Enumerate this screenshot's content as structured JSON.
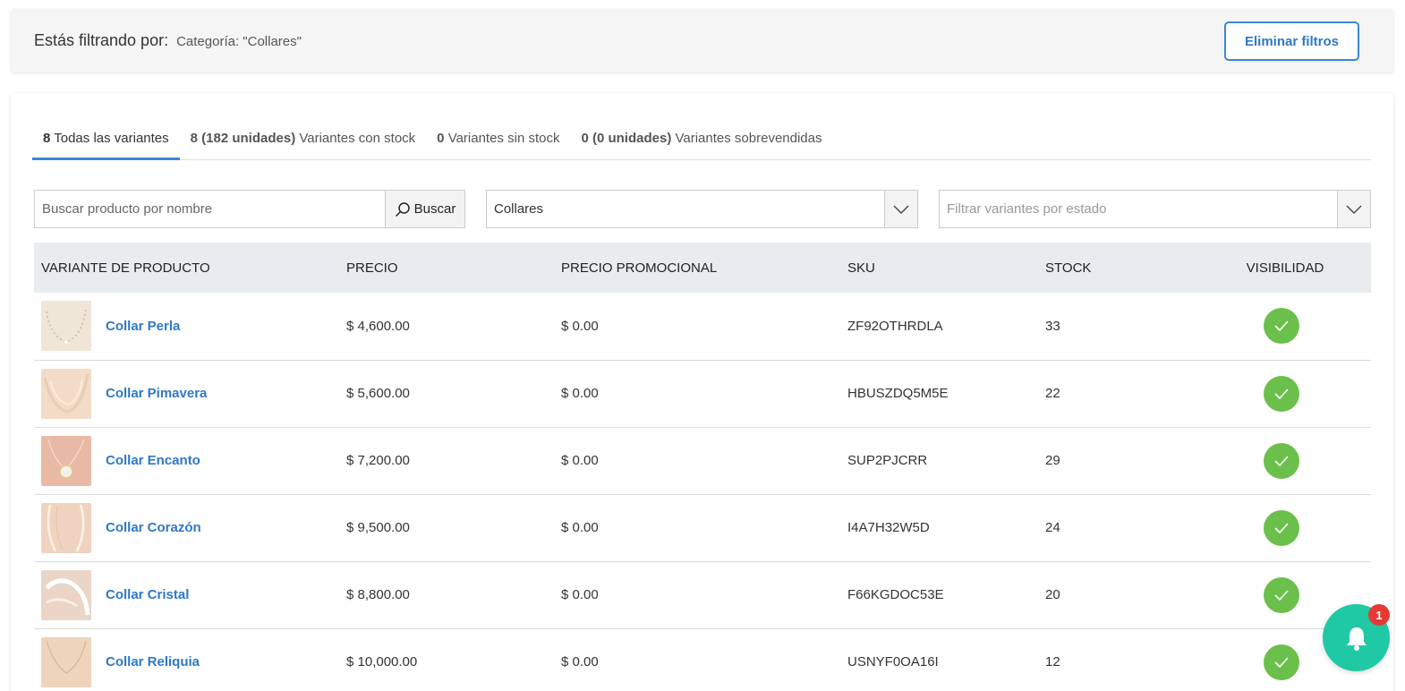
{
  "filter_bar": {
    "title": "Estás filtrando por:",
    "value": "Categoría: \"Collares\"",
    "clear_button": "Eliminar filtros"
  },
  "tabs": [
    {
      "count": "8",
      "label": "Todas las variantes",
      "active": true
    },
    {
      "count": "8 (182 unidades)",
      "label": "Variantes con stock",
      "active": false
    },
    {
      "count": "0",
      "label": "Variantes sin stock",
      "active": false
    },
    {
      "count": "0 (0 unidades)",
      "label": "Variantes sobrevendidas",
      "active": false
    }
  ],
  "search": {
    "placeholder": "Buscar producto por nombre",
    "button_label": "Buscar",
    "icon": "search-icon"
  },
  "category_select": {
    "value": "Collares"
  },
  "status_select": {
    "placeholder": "Filtrar variantes por estado"
  },
  "table": {
    "headers": [
      "VARIANTE DE PRODUCTO",
      "PRECIO",
      "PRECIO PROMOCIONAL",
      "SKU",
      "STOCK",
      "VISIBILIDAD"
    ],
    "rows": [
      {
        "name": "Collar Perla",
        "price": "$ 4,600.00",
        "promo": "$ 0.00",
        "sku": "ZF92OTHRDLA",
        "stock": "33",
        "visible": true
      },
      {
        "name": "Collar Pimavera",
        "price": "$ 5,600.00",
        "promo": "$ 0.00",
        "sku": "HBUSZDQ5M5E",
        "stock": "22",
        "visible": true
      },
      {
        "name": "Collar Encanto",
        "price": "$ 7,200.00",
        "promo": "$ 0.00",
        "sku": "SUP2PJCRR",
        "stock": "29",
        "visible": true
      },
      {
        "name": "Collar Corazón",
        "price": "$ 9,500.00",
        "promo": "$ 0.00",
        "sku": "I4A7H32W5D",
        "stock": "24",
        "visible": true
      },
      {
        "name": "Collar Cristal",
        "price": "$ 8,800.00",
        "promo": "$ 0.00",
        "sku": "F66KGDOC53E",
        "stock": "20",
        "visible": true
      },
      {
        "name": "Collar Reliquia",
        "price": "$ 10,000.00",
        "promo": "$ 0.00",
        "sku": "USNYF0OA16I",
        "stock": "12",
        "visible": true
      }
    ]
  },
  "notifications": {
    "count": "1",
    "icon": "bell-icon"
  },
  "colors": {
    "accent": "#3a86d9",
    "visible_check": "#6bc04b",
    "bell": "#20c9a6",
    "badge": "#e53935"
  }
}
